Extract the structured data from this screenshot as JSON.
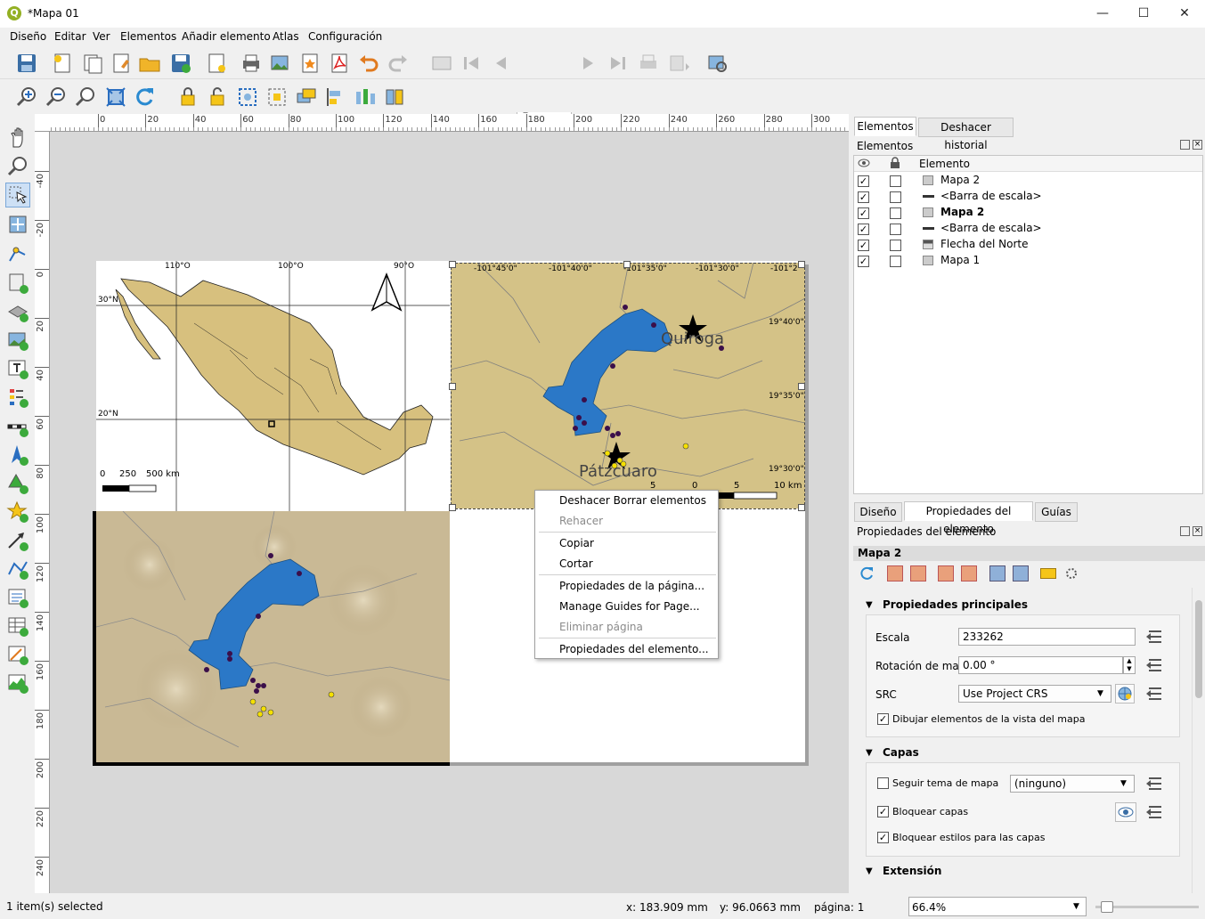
{
  "window": {
    "title": "*Mapa 01",
    "logo": "Q",
    "minimize": "—",
    "maximize": "☐",
    "close": "✕"
  },
  "menu": [
    "Diseño",
    "Editar",
    "Ver",
    "Elementos",
    "Añadir elemento",
    "Atlas",
    "Configuración"
  ],
  "toolbar": {
    "page_value": "1"
  },
  "rulers": {
    "top": [
      "0",
      "20",
      "40",
      "60",
      "80",
      "100",
      "120",
      "140",
      "160",
      "180",
      "200",
      "220",
      "240",
      "260",
      "280",
      "300"
    ],
    "left": [
      "-40",
      "-20",
      "0",
      "20",
      "40",
      "60",
      "80",
      "100",
      "120",
      "140",
      "160",
      "180",
      "200",
      "220",
      "240"
    ]
  },
  "map1": {
    "lon_labels": [
      "110°O",
      "100°O",
      "90°O"
    ],
    "lat_labels": [
      "30°N",
      "20°N"
    ],
    "scale_labels": [
      "0",
      "250",
      "500 km"
    ]
  },
  "map2": {
    "lon_labels": [
      "-101°45'0\"",
      "-101°40'0\"",
      "-101°35'0\"",
      "-101°30'0\"",
      "-101°2"
    ],
    "lat_labels": [
      "19°40'0\"",
      "19°35'0\"",
      "19°30'0\""
    ],
    "places": [
      "Quiroga",
      "Pátzcuaro"
    ],
    "scale_labels": [
      "5",
      "0",
      "5",
      "10 km"
    ]
  },
  "context_menu": {
    "items": [
      {
        "label": "Deshacer Borrar elementos",
        "enabled": true
      },
      {
        "label": "Rehacer",
        "enabled": false
      },
      {
        "label": "Copiar",
        "enabled": true
      },
      {
        "label": "Cortar",
        "enabled": true
      },
      {
        "label": "Propiedades de la página...",
        "enabled": true
      },
      {
        "label": "Manage Guides for Page...",
        "enabled": true
      },
      {
        "label": "Eliminar página",
        "enabled": false
      },
      {
        "label": "Propiedades del elemento...",
        "enabled": true
      }
    ]
  },
  "top_panel": {
    "tabs": [
      "Elementos",
      "Deshacer historial"
    ],
    "title": "Elementos",
    "column": "Elemento",
    "items": [
      {
        "name": "Mapa 2",
        "icon": "map-icon",
        "visible": true,
        "locked": false,
        "bold": false
      },
      {
        "name": "<Barra de escala>",
        "icon": "scalebar-icon",
        "visible": true,
        "locked": false,
        "bold": false
      },
      {
        "name": "Mapa 2",
        "icon": "map-icon",
        "visible": true,
        "locked": false,
        "bold": true
      },
      {
        "name": "<Barra de escala>",
        "icon": "scalebar-icon",
        "visible": true,
        "locked": false,
        "bold": false
      },
      {
        "name": "Flecha del Norte",
        "icon": "picture-icon",
        "visible": true,
        "locked": false,
        "bold": false
      },
      {
        "name": "Mapa 1",
        "icon": "map-icon",
        "visible": true,
        "locked": false,
        "bold": false
      }
    ]
  },
  "bottom_panel": {
    "tabs": [
      "Diseño",
      "Propiedades del elemento",
      "Guías"
    ],
    "title": "Propiedades del elemento",
    "item_name": "Mapa 2",
    "groups": {
      "main": "Propiedades principales",
      "layers": "Capas",
      "extent": "Extensión"
    },
    "scale": {
      "label": "Escala",
      "value": "233262"
    },
    "rotation": {
      "label": "Rotación de mapa",
      "value": "0.00 °"
    },
    "crs": {
      "label": "SRC",
      "value": "Use Project CRS"
    },
    "draw_items": {
      "label": "Dibujar elementos de la vista del mapa",
      "checked": true
    },
    "follow_theme": {
      "label": "Seguir tema de mapa",
      "checked": false,
      "value": "(ninguno)"
    },
    "lock_layers": {
      "label": "Bloquear capas",
      "checked": true
    },
    "lock_styles": {
      "label": "Bloquear estilos para las capas",
      "checked": true
    }
  },
  "status": {
    "selected": "1 item(s) selected",
    "x": "x: 183.909 mm",
    "y": "y: 96.0663 mm",
    "page": "página: 1",
    "zoom": "66.4%",
    "zoom_level": 0.05
  }
}
